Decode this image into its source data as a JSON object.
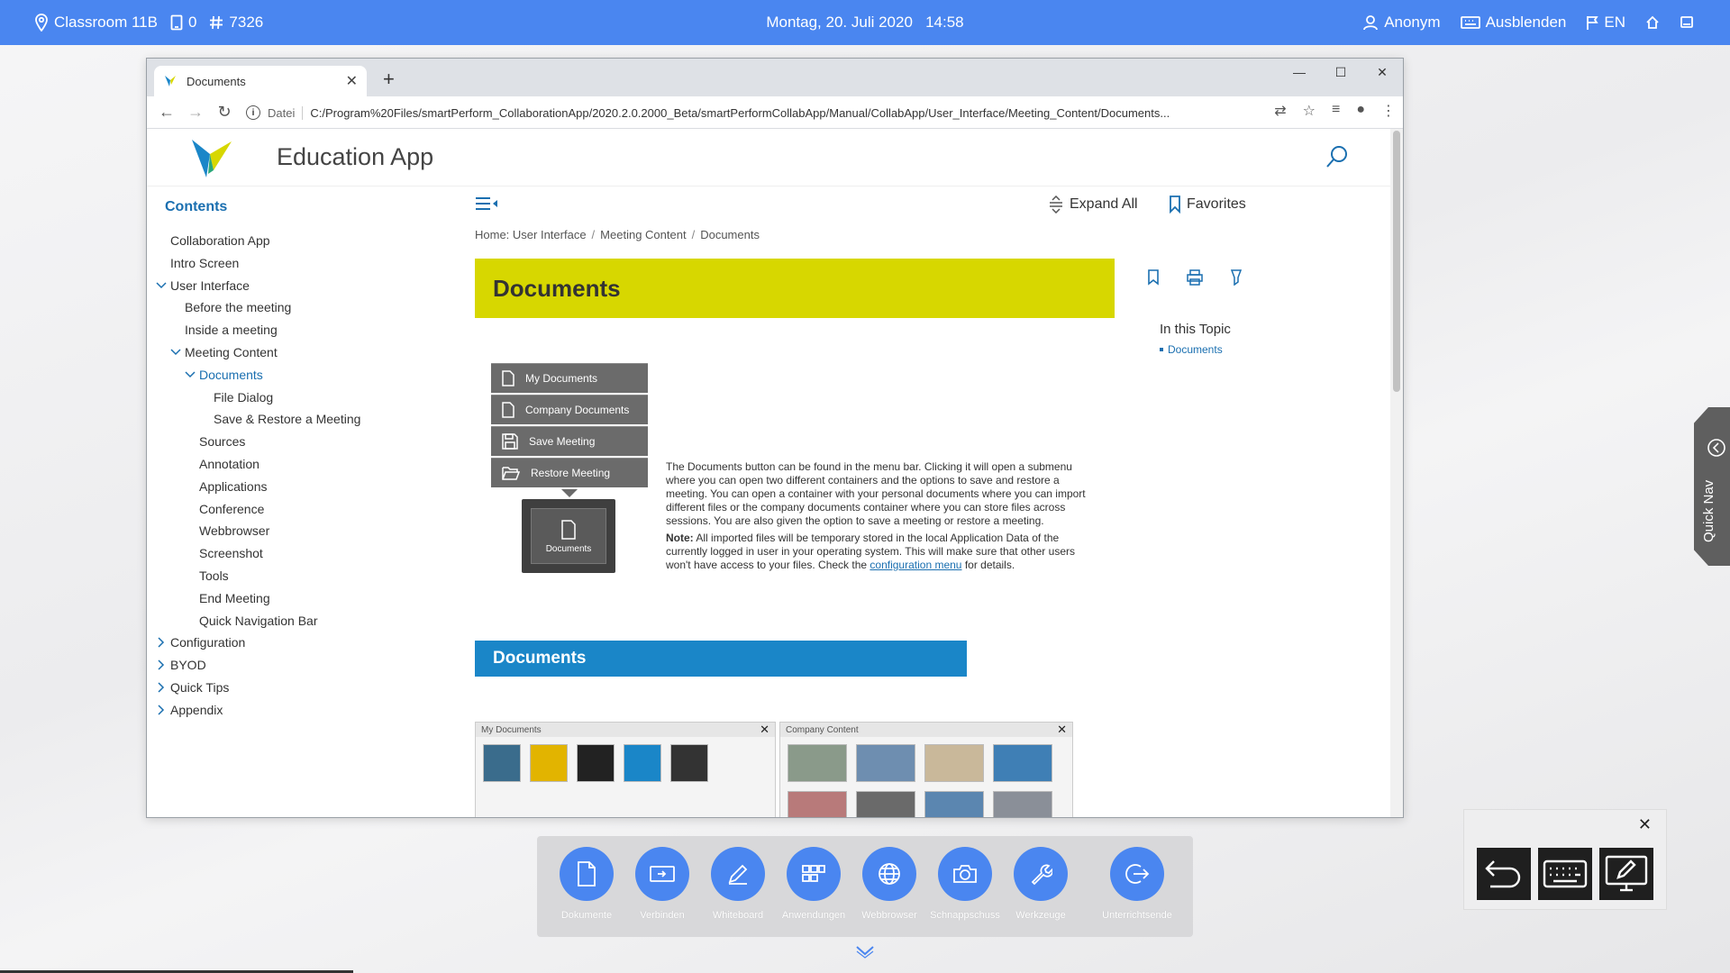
{
  "topbar": {
    "room": "Classroom 11B",
    "screen_count": "0",
    "session_id": "7326",
    "datetime": "Montag, 20. Juli 2020   14:58",
    "user": "Anonym",
    "hide": "Ausblenden",
    "language": "EN",
    "bg_color": "#4a86f0"
  },
  "browser": {
    "tab_title": "Documents",
    "scheme_label": "Datei",
    "url": "C:/Program%20Files/smartPerform_CollaborationApp/2020.2.0.2000_Beta/smartPerformCollabApp/Manual/CollabApp/User_Interface/Meeting_Content/Documents..."
  },
  "app": {
    "title": "Education App",
    "sidebar_heading": "Contents",
    "expand_all": "Expand All",
    "favorites": "Favorites",
    "accent": "#1a6fb0"
  },
  "toc": [
    {
      "label": "Collaboration App",
      "level": 0,
      "caret": ""
    },
    {
      "label": "Intro Screen",
      "level": 0,
      "caret": ""
    },
    {
      "label": "User Interface",
      "level": 0,
      "caret": "open"
    },
    {
      "label": "Before the meeting",
      "level": 1,
      "caret": ""
    },
    {
      "label": "Inside a meeting",
      "level": 1,
      "caret": ""
    },
    {
      "label": "Meeting Content",
      "level": 1,
      "caret": "open"
    },
    {
      "label": "Documents",
      "level": 2,
      "caret": "open",
      "active": true
    },
    {
      "label": "File Dialog",
      "level": 3,
      "caret": ""
    },
    {
      "label": "Save & Restore a Meeting",
      "level": 3,
      "caret": ""
    },
    {
      "label": "Sources",
      "level": 2,
      "caret": ""
    },
    {
      "label": "Annotation",
      "level": 2,
      "caret": ""
    },
    {
      "label": "Applications",
      "level": 2,
      "caret": ""
    },
    {
      "label": "Conference",
      "level": 2,
      "caret": ""
    },
    {
      "label": "Webbrowser",
      "level": 2,
      "caret": ""
    },
    {
      "label": "Screenshot",
      "level": 2,
      "caret": ""
    },
    {
      "label": "Tools",
      "level": 2,
      "caret": ""
    },
    {
      "label": "End Meeting",
      "level": 2,
      "caret": ""
    },
    {
      "label": "Quick Navigation Bar",
      "level": 2,
      "caret": ""
    },
    {
      "label": "Configuration",
      "level": 0,
      "caret": "closed"
    },
    {
      "label": "BYOD",
      "level": 0,
      "caret": "closed"
    },
    {
      "label": "Quick Tips",
      "level": 0,
      "caret": "closed"
    },
    {
      "label": "Appendix",
      "level": 0,
      "caret": "closed"
    }
  ],
  "breadcrumb": {
    "home": "Home: User Interface",
    "parent": "Meeting Content",
    "current": "Documents"
  },
  "article": {
    "title": "Documents",
    "title_bg": "#d7d700",
    "in_topic_heading": "In this Topic",
    "in_topic_link": "Documents",
    "menu_items": [
      "My Documents",
      "Company Documents",
      "Save Meeting",
      "Restore Meeting"
    ],
    "doc_button_label": "Documents",
    "paragraph": "The Documents button can be found in the menu bar. Clicking it will open a submenu where you can open two different containers and the options to save and restore a meeting. You can open a container with your personal documents where you can import different files or the company documents container where you can store files across sessions. You are also given the option to save a meeting or restore a meeting.",
    "note_label": "Note:",
    "note_before_link": " All imported files will be temporary stored in the local Application Data of the currently logged in user in your operating system. This will make sure that other users won't have access to your files. Check the ",
    "note_link": "configuration menu",
    "note_after_link": " for details.",
    "section_title": "Documents",
    "section_bg": "#1a86c8",
    "shot_left_title": "My Documents",
    "shot_right_title": "Company Content"
  },
  "dock": {
    "items": [
      "Dokumente",
      "Verbinden",
      "Whiteboard",
      "Anwendungen",
      "Webbrowser",
      "Schnappschuss",
      "Werkzeuge",
      "Unterrichtsende"
    ]
  },
  "quicknav": {
    "label": "Quick Nav"
  }
}
